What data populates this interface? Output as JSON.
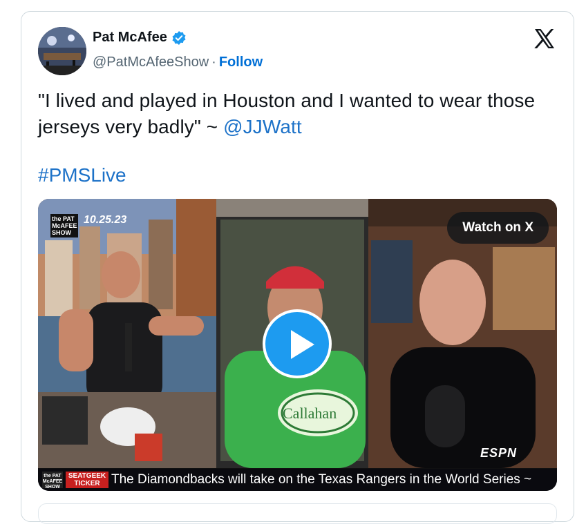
{
  "tweet": {
    "author_name": "Pat McAfee",
    "handle": "@PatMcAfeeShow",
    "separator": "·",
    "follow_label": "Follow",
    "text_part1": "\"I lived and played in Houston and I wanted to wear those jerseys very badly\" ~ ",
    "mention": "@JJWatt",
    "hashtag": "#PMSLive"
  },
  "media": {
    "watch_label": "Watch on X",
    "show_logo": "the PAT McAFEE SHOW",
    "date_overlay": "10.25.23",
    "shirt_text": "Callahan",
    "network_logo": "ESPN",
    "ticker_logo": "the PAT McAFEE SHOW",
    "ticker_brand": "SEATGEEK TICKER",
    "ticker_text": "The Diamondbacks will take on the Texas Rangers in the World Series ~"
  },
  "colors": {
    "accent": "#1d9bf0",
    "link": "#1d72c8",
    "follow": "#006fd6",
    "muted": "#536471"
  },
  "icons": [
    "verified-badge-icon",
    "x-logo-icon",
    "play-icon"
  ]
}
